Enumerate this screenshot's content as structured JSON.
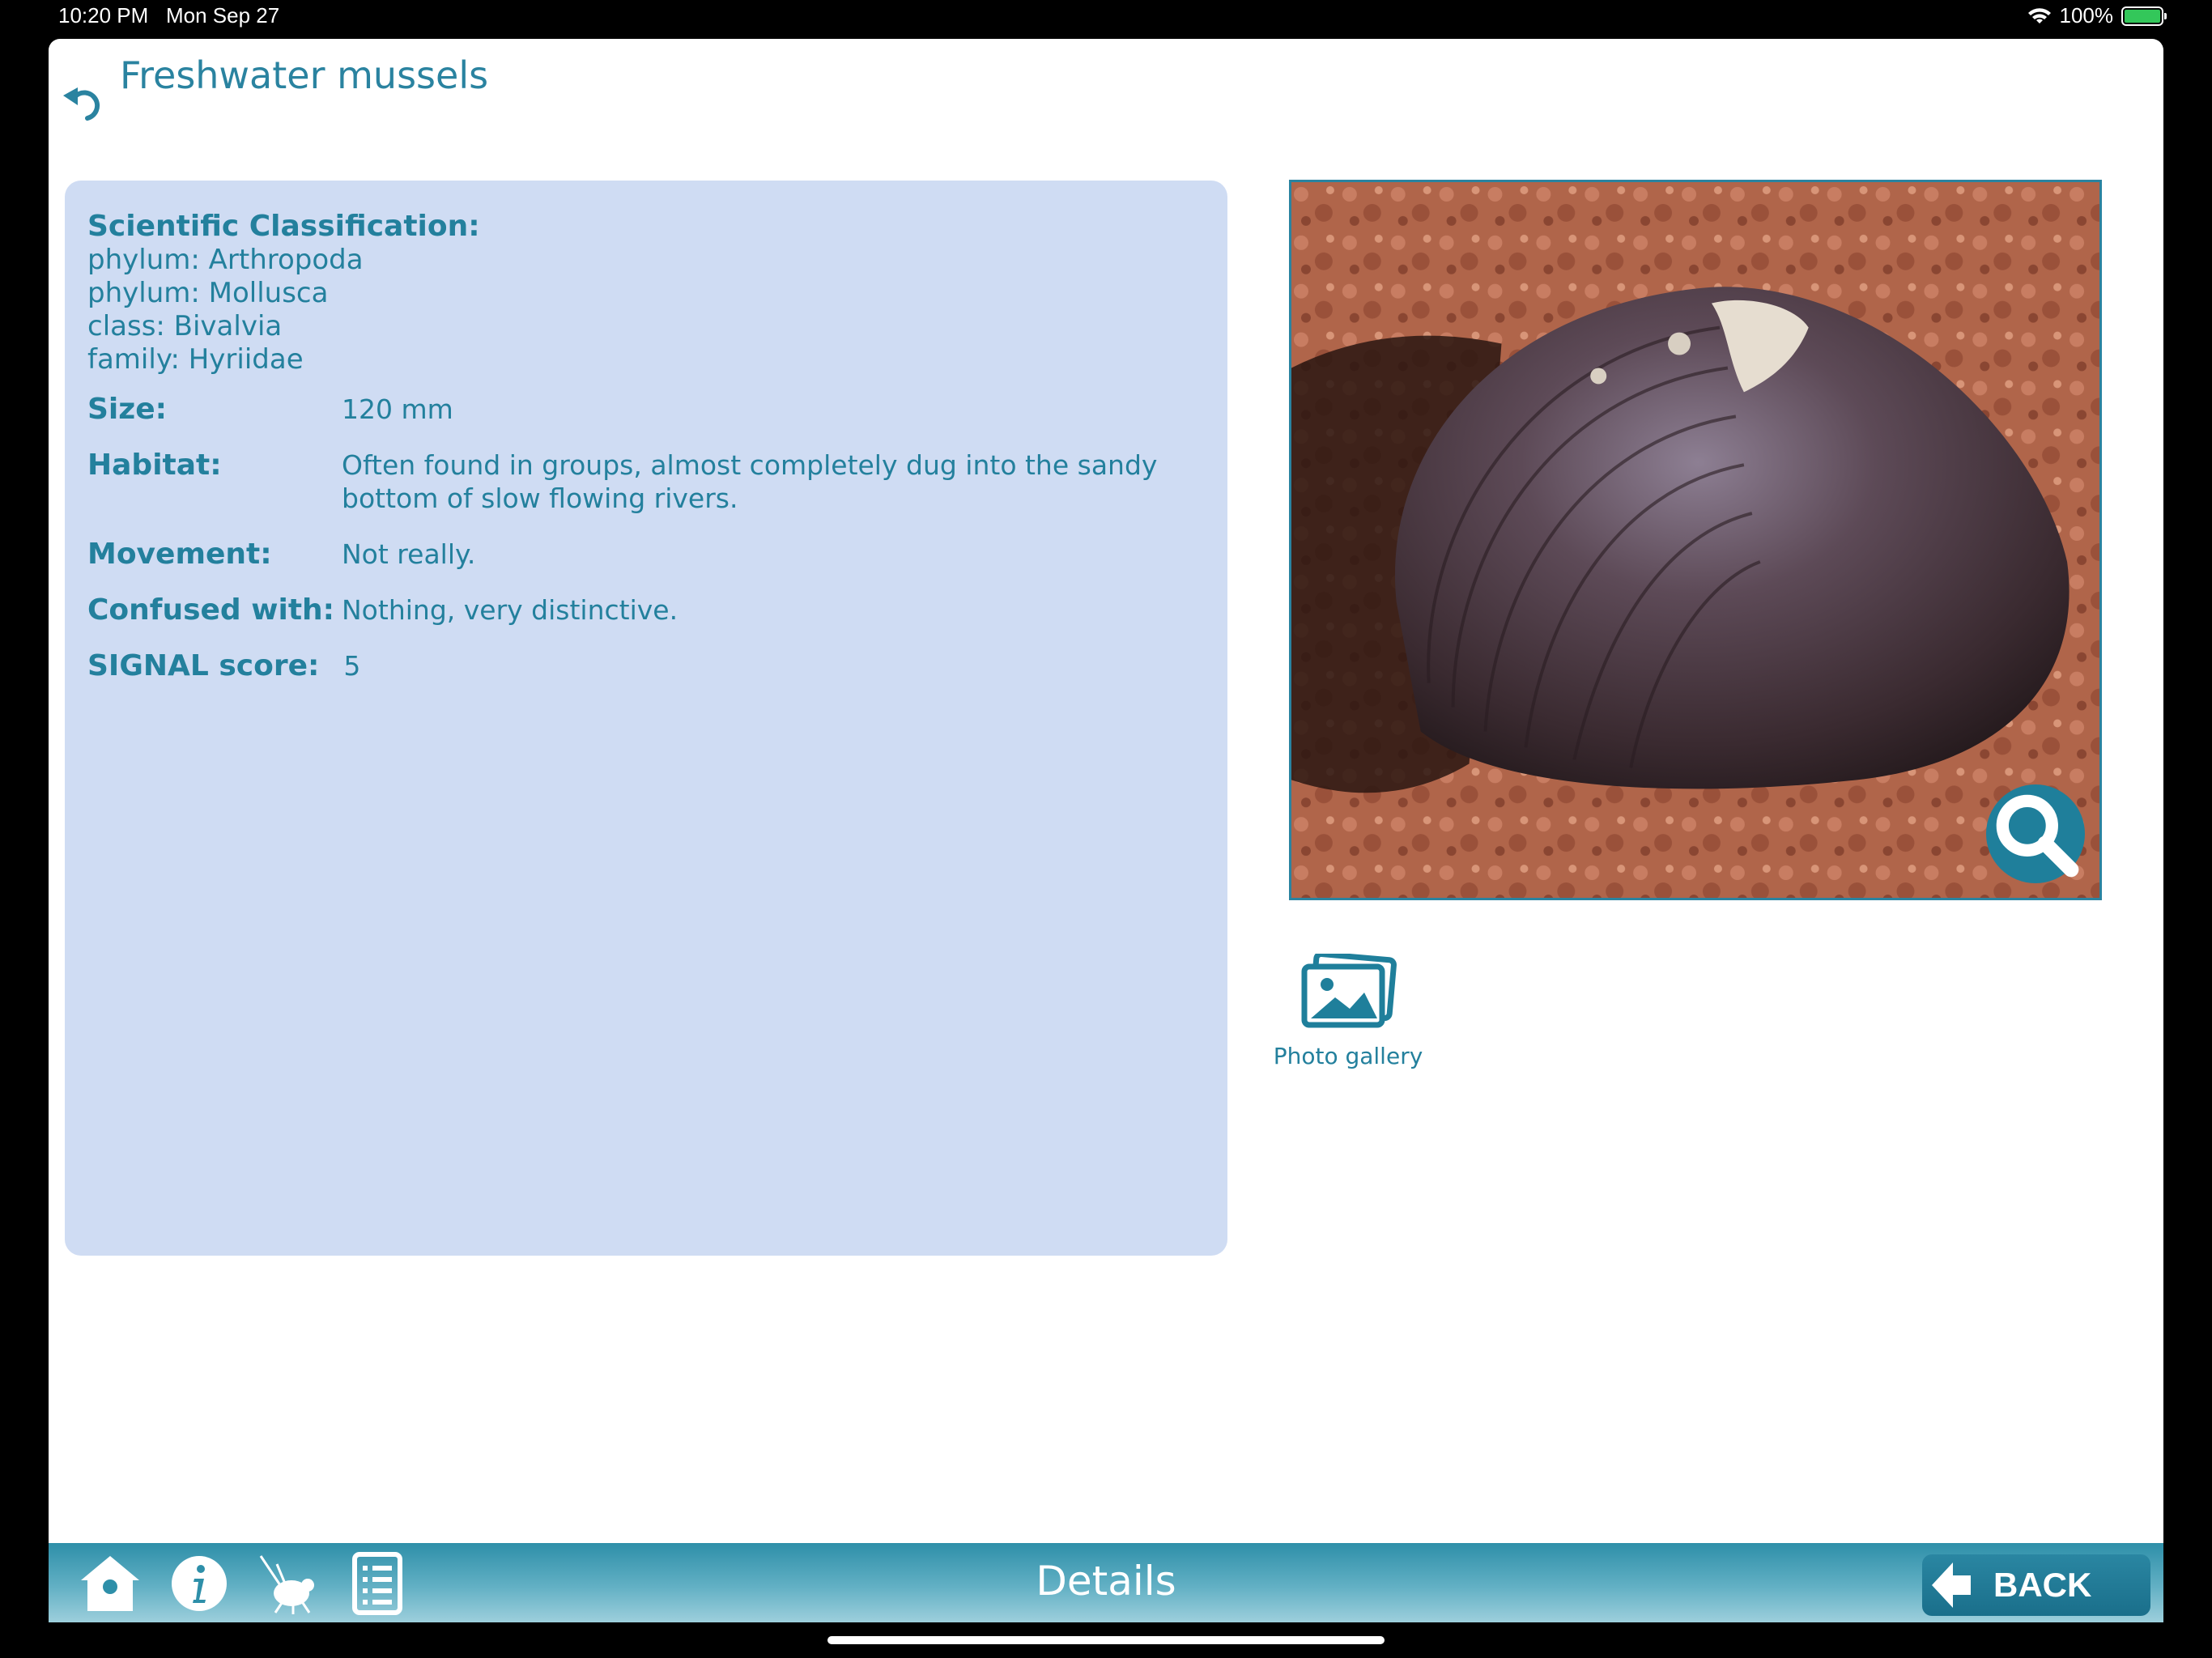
{
  "status_bar": {
    "time": "10:20 PM",
    "date": "Mon Sep 27",
    "battery": "100%"
  },
  "header": {
    "title": "Freshwater mussels"
  },
  "classification": {
    "heading": "Scientific Classification:",
    "lines": [
      "phylum: Arthropoda",
      "phylum: Mollusca",
      "class: Bivalvia",
      "family: Hyriidae"
    ]
  },
  "details": {
    "size": {
      "label": "Size:",
      "value": "120 mm"
    },
    "habitat": {
      "label": "Habitat:",
      "value": "Often found in groups, almost completely dug into the sandy bottom of slow flowing rivers."
    },
    "movement": {
      "label": "Movement:",
      "value": "Not really."
    },
    "confused": {
      "label": "Confused with:",
      "value": "Nothing, very distinctive."
    },
    "signal": {
      "label": "SIGNAL score:",
      "value": "5"
    }
  },
  "photo": {
    "zoom_icon": "search-icon"
  },
  "gallery": {
    "label": "Photo gallery",
    "icon": "photo-gallery-icon"
  },
  "toolbar": {
    "title": "Details",
    "back_label": "BACK",
    "icons": [
      "home-icon",
      "info-icon",
      "bug-icon",
      "list-icon"
    ]
  },
  "colors": {
    "accent": "#2a83a0",
    "panel": "#cfdcf3",
    "bar": "#2e8fa9"
  }
}
